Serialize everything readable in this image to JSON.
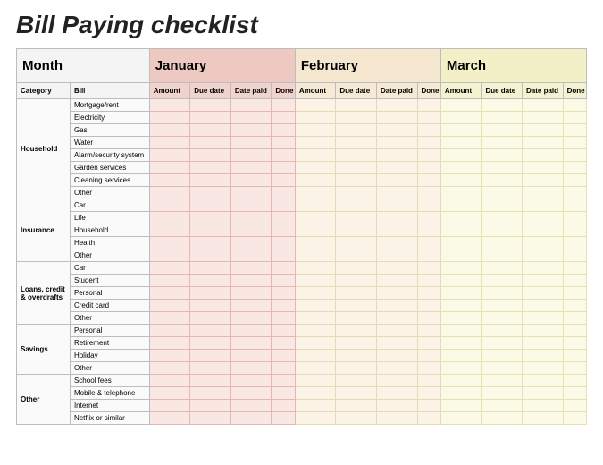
{
  "title": "Bill Paying checklist",
  "month_label": "Month",
  "months": [
    "January",
    "February",
    "March"
  ],
  "subheaders": {
    "category": "Category",
    "bill": "Bill",
    "amount": "Amount",
    "due": "Due date",
    "paid": "Date paid",
    "done": "Done"
  },
  "categories": [
    {
      "name": "Household",
      "bills": [
        "Mortgage/rent",
        "Electricity",
        "Gas",
        "Water",
        "Alarm/security system",
        "Garden services",
        "Cleaning services",
        "Other"
      ]
    },
    {
      "name": "Insurance",
      "bills": [
        "Car",
        "Life",
        "Household",
        "Health",
        "Other"
      ]
    },
    {
      "name": "Loans, credit & overdrafts",
      "bills": [
        "Car",
        "Student",
        "Personal",
        "Credit card",
        "Other"
      ]
    },
    {
      "name": "Savings",
      "bills": [
        "Personal",
        "Retirement",
        "Holiday",
        "Other"
      ]
    },
    {
      "name": "Other",
      "bills": [
        "School fees",
        "Mobile & telephone",
        "Internet",
        "Netflix or similar"
      ]
    }
  ]
}
